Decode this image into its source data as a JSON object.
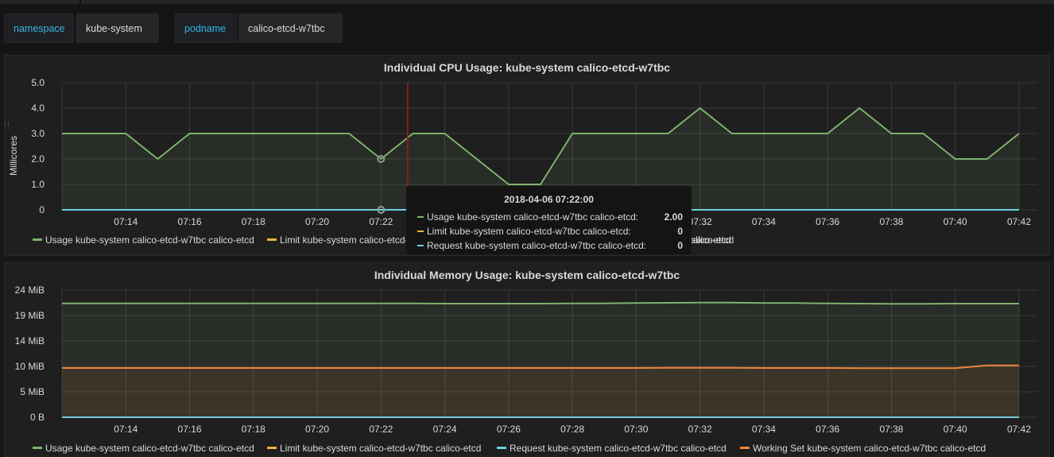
{
  "variables": [
    {
      "label": "namespace",
      "value": "kube-system"
    },
    {
      "label": "podname",
      "value": "calico-etcd-w7tbc"
    }
  ],
  "cpu_panel": {
    "title": "Individual CPU Usage: kube-system calico-etcd-w7tbc",
    "ylabel": "Millicores",
    "legend": [
      {
        "label": "Usage kube-system calico-etcd-w7tbc calico-etcd",
        "color": "#7eb26d"
      },
      {
        "label": "Limit kube-system calico-etcd-w7tbc calico-etcd",
        "color": "#eab839"
      },
      {
        "label": "Request kube-system calico-etcd-w7tbc calico-etcd",
        "color": "#6ed0e0"
      }
    ],
    "legend_tail": "calico-etcd",
    "tooltip": {
      "time": "2018-04-06 07:22:00",
      "rows": [
        {
          "label": "Usage kube-system calico-etcd-w7tbc calico-etcd:",
          "value": "2.00",
          "color": "#7eb26d"
        },
        {
          "label": "Limit kube-system calico-etcd-w7tbc calico-etcd:",
          "value": "0",
          "color": "#eab839"
        },
        {
          "label": "Request kube-system calico-etcd-w7tbc calico-etcd:",
          "value": "0",
          "color": "#6ed0e0"
        }
      ]
    }
  },
  "mem_panel": {
    "title": "Individual Memory Usage: kube-system calico-etcd-w7tbc",
    "legend": [
      {
        "label": "Usage kube-system calico-etcd-w7tbc calico-etcd",
        "color": "#7eb26d"
      },
      {
        "label": "Limit kube-system calico-etcd-w7tbc calico-etcd",
        "color": "#eab839"
      },
      {
        "label": "Request kube-system calico-etcd-w7tbc calico-etcd",
        "color": "#6ed0e0"
      },
      {
        "label": "Working Set kube-system calico-etcd-w7tbc calico-etcd",
        "color": "#ef843c"
      }
    ]
  },
  "chart_data": [
    {
      "type": "line",
      "title": "Individual CPU Usage: kube-system calico-etcd-w7tbc",
      "ylabel": "Millicores",
      "ylim": [
        0,
        5
      ],
      "y_ticks": [
        "0",
        "1.0",
        "2.0",
        "3.0",
        "4.0",
        "5.0"
      ],
      "x_ticks": [
        "07:14",
        "07:16",
        "07:18",
        "07:20",
        "07:22",
        "07:24",
        "07:26",
        "07:28",
        "07:30",
        "07:32",
        "07:34",
        "07:36",
        "07:38",
        "07:40",
        "07:42"
      ],
      "x": [
        "07:12",
        "07:13",
        "07:14",
        "07:15",
        "07:16",
        "07:17",
        "07:18",
        "07:19",
        "07:20",
        "07:21",
        "07:22",
        "07:23",
        "07:24",
        "07:25",
        "07:26",
        "07:27",
        "07:28",
        "07:29",
        "07:30",
        "07:31",
        "07:32",
        "07:33",
        "07:34",
        "07:35",
        "07:36",
        "07:37",
        "07:38",
        "07:39",
        "07:40",
        "07:41",
        "07:42"
      ],
      "series": [
        {
          "name": "Usage kube-system calico-etcd-w7tbc calico-etcd",
          "color": "#7eb26d",
          "values": [
            3,
            3,
            3,
            2,
            3,
            3,
            3,
            3,
            3,
            3,
            2,
            3,
            3,
            2,
            1,
            1,
            3,
            3,
            3,
            3,
            4,
            3,
            3,
            3,
            3,
            4,
            3,
            3,
            2,
            2,
            3
          ]
        },
        {
          "name": "Limit kube-system calico-etcd-w7tbc calico-etcd",
          "color": "#eab839",
          "values": [
            0,
            0,
            0,
            0,
            0,
            0,
            0,
            0,
            0,
            0,
            0,
            0,
            0,
            0,
            0,
            0,
            0,
            0,
            0,
            0,
            0,
            0,
            0,
            0,
            0,
            0,
            0,
            0,
            0,
            0,
            0
          ]
        },
        {
          "name": "Request kube-system calico-etcd-w7tbc calico-etcd",
          "color": "#6ed0e0",
          "values": [
            0,
            0,
            0,
            0,
            0,
            0,
            0,
            0,
            0,
            0,
            0,
            0,
            0,
            0,
            0,
            0,
            0,
            0,
            0,
            0,
            0,
            0,
            0,
            0,
            0,
            0,
            0,
            0,
            0,
            0,
            0
          ]
        }
      ],
      "hover_time": "07:22",
      "marker_time": "07:22:50",
      "grid": true
    },
    {
      "type": "line",
      "title": "Individual Memory Usage: kube-system calico-etcd-w7tbc",
      "ylim": [
        0,
        24
      ],
      "y_ticks": [
        "0 B",
        "5 MiB",
        "10 MiB",
        "14 MiB",
        "19 MiB",
        "24 MiB"
      ],
      "x_ticks": [
        "07:14",
        "07:16",
        "07:18",
        "07:20",
        "07:22",
        "07:24",
        "07:26",
        "07:28",
        "07:30",
        "07:32",
        "07:34",
        "07:36",
        "07:38",
        "07:40",
        "07:42"
      ],
      "x": [
        "07:12",
        "07:13",
        "07:14",
        "07:15",
        "07:16",
        "07:17",
        "07:18",
        "07:19",
        "07:20",
        "07:21",
        "07:22",
        "07:23",
        "07:24",
        "07:25",
        "07:26",
        "07:27",
        "07:28",
        "07:29",
        "07:30",
        "07:31",
        "07:32",
        "07:33",
        "07:34",
        "07:35",
        "07:36",
        "07:37",
        "07:38",
        "07:39",
        "07:40",
        "07:41",
        "07:42"
      ],
      "series": [
        {
          "name": "Usage kube-system calico-etcd-w7tbc calico-etcd",
          "color": "#7eb26d",
          "values": [
            21.5,
            21.5,
            21.5,
            21.5,
            21.5,
            21.5,
            21.5,
            21.5,
            21.5,
            21.5,
            21.5,
            21.5,
            21.45,
            21.45,
            21.45,
            21.45,
            21.5,
            21.5,
            21.55,
            21.6,
            21.65,
            21.65,
            21.55,
            21.55,
            21.5,
            21.45,
            21.4,
            21.4,
            21.45,
            21.45,
            21.45
          ]
        },
        {
          "name": "Limit kube-system calico-etcd-w7tbc calico-etcd",
          "color": "#eab839",
          "values": [
            0,
            0,
            0,
            0,
            0,
            0,
            0,
            0,
            0,
            0,
            0,
            0,
            0,
            0,
            0,
            0,
            0,
            0,
            0,
            0,
            0,
            0,
            0,
            0,
            0,
            0,
            0,
            0,
            0,
            0,
            0
          ]
        },
        {
          "name": "Request kube-system calico-etcd-w7tbc calico-etcd",
          "color": "#6ed0e0",
          "values": [
            0,
            0,
            0,
            0,
            0,
            0,
            0,
            0,
            0,
            0,
            0,
            0,
            0,
            0,
            0,
            0,
            0,
            0,
            0,
            0,
            0,
            0,
            0,
            0,
            0,
            0,
            0,
            0,
            0,
            0,
            0
          ]
        },
        {
          "name": "Working Set kube-system calico-etcd-w7tbc calico-etcd",
          "color": "#ef843c",
          "values": [
            9.3,
            9.3,
            9.3,
            9.3,
            9.3,
            9.3,
            9.3,
            9.3,
            9.3,
            9.3,
            9.3,
            9.3,
            9.3,
            9.3,
            9.3,
            9.3,
            9.3,
            9.3,
            9.3,
            9.35,
            9.35,
            9.35,
            9.3,
            9.3,
            9.3,
            9.25,
            9.25,
            9.25,
            9.25,
            9.8,
            9.8
          ]
        }
      ],
      "grid": true
    }
  ]
}
